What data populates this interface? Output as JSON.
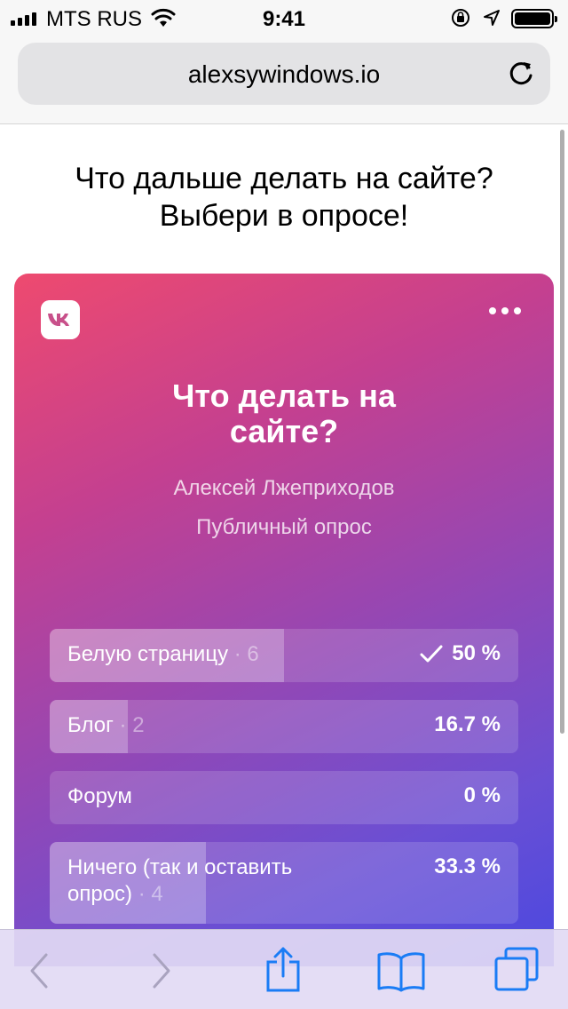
{
  "status_bar": {
    "carrier": "MTS RUS",
    "time": "9:41",
    "signal_icon": "signal-bars-icon",
    "wifi_icon": "wifi-icon",
    "rotation_lock_icon": "rotation-lock-icon",
    "location_icon": "location-arrow-icon",
    "battery_icon": "battery-icon"
  },
  "address_bar": {
    "url": "alexsywindows.io",
    "reload_icon": "reload-icon"
  },
  "page": {
    "heading_line1": "Что дальше делать на сайте?",
    "heading_line2": "Выбери в опросе!"
  },
  "poll": {
    "title": "Что делать на сайте?",
    "author": "Алексей Лжеприходов",
    "type": "Публичный опрос",
    "accent_gradient": [
      "#ee4a6f",
      "#c44090",
      "#8f48b8",
      "#4a48e0"
    ],
    "options": [
      {
        "label": "Белую страницу",
        "count": "· 6",
        "percent": "50 %",
        "share": 0.5,
        "selected": true
      },
      {
        "label": "Блог",
        "count": "· 2",
        "percent": "16.7 %",
        "share": 0.167,
        "selected": false
      },
      {
        "label": "Форум",
        "count": "",
        "percent": "0 %",
        "share": 0,
        "selected": false
      },
      {
        "label": "Ничего (так и оставить опрос)",
        "count": "· 4",
        "percent": "33.3 %",
        "share": 0.333,
        "selected": false
      }
    ]
  },
  "toolbar": {
    "icons": [
      "back-icon",
      "forward-icon",
      "share-icon",
      "bookmarks-icon",
      "tabs-icon"
    ]
  }
}
